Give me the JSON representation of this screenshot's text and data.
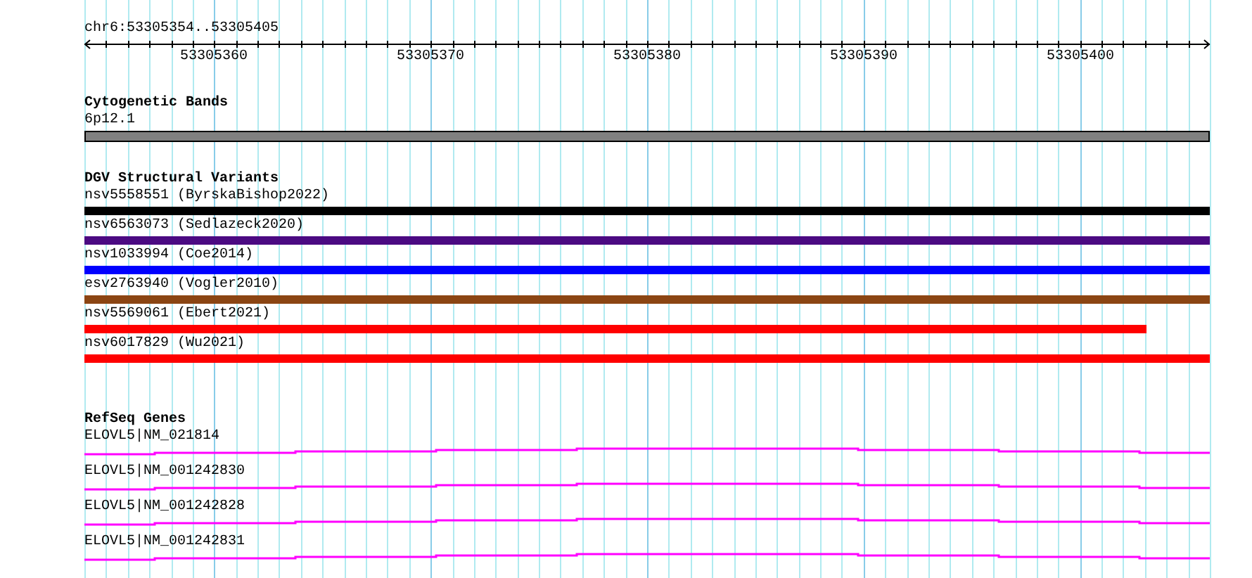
{
  "ruler": {
    "location": "chr6:53305354..53305405",
    "ticks": [
      "53305360",
      "53305370",
      "53305380",
      "53305390",
      "53305400"
    ]
  },
  "cytogenetic_bands": {
    "title": "Cytogenetic Bands",
    "band": "6p12.1"
  },
  "dgv_structural_variants": {
    "title": "DGV Structural Variants",
    "items": [
      {
        "label": "nsv5558551 (ByrskaBishop2022)",
        "color": "#000000",
        "runs_past_view": true
      },
      {
        "label": "nsv6563073 (Sedlazeck2020)",
        "color": "#4b0a82",
        "runs_past_view": true
      },
      {
        "label": "nsv1033994 (Coe2014)",
        "color": "#0000ff",
        "runs_past_view": true
      },
      {
        "label": "esv2763940 (Vogler2010)",
        "color": "#8b4513",
        "runs_past_view": true
      },
      {
        "label": "nsv5569061 (Ebert2021)",
        "color": "#ff0000",
        "runs_past_view": false
      },
      {
        "label": "nsv6017829 (Wu2021)",
        "color": "#ff0000",
        "runs_past_view": true
      }
    ]
  },
  "refseq_genes": {
    "title": "RefSeq Genes",
    "items": [
      {
        "label": "ELOVL5|NM_021814"
      },
      {
        "label": "ELOVL5|NM_001242830"
      },
      {
        "label": "ELOVL5|NM_001242828"
      },
      {
        "label": "ELOVL5|NM_001242831"
      }
    ]
  }
}
